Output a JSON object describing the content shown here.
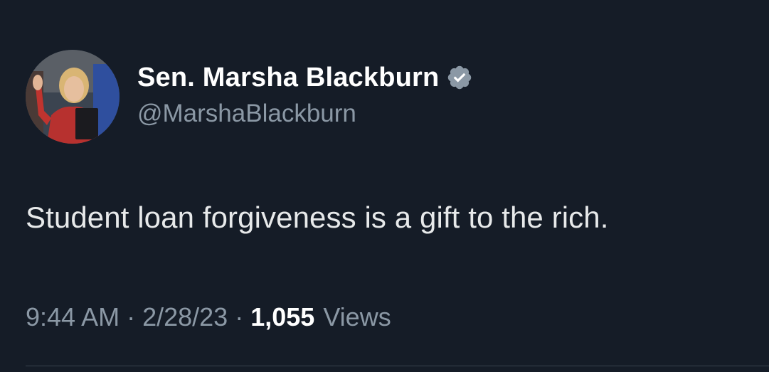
{
  "author": {
    "display_name": "Sen. Marsha Blackburn",
    "handle": "@MarshaBlackburn",
    "verified": true,
    "verified_icon": "verified-badge-icon",
    "verified_color": "#8b98a5"
  },
  "tweet": {
    "text": "Student loan forgiveness is a gift to the rich."
  },
  "meta": {
    "time": "9:44 AM",
    "separator": "·",
    "date": "2/28/23",
    "views_count": "1,055",
    "views_label": "Views"
  },
  "colors": {
    "background": "#151c27",
    "text_primary": "#ffffff",
    "text_secondary": "#8b98a5",
    "divider": "#38444d"
  }
}
